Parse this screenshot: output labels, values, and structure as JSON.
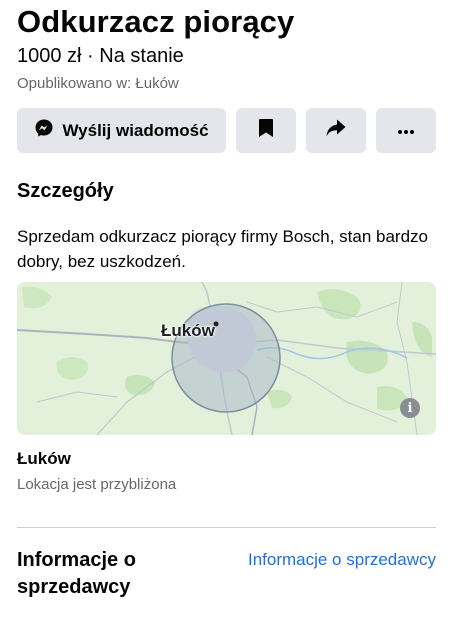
{
  "listing": {
    "title": "Odkurzacz piorący",
    "price_line": "1000 zł · Na stanie",
    "published": "Opublikowano w: Łuków"
  },
  "actions": {
    "message_label": "Wyślij wiadomość",
    "message_icon": "messenger-icon",
    "save_icon": "bookmark-icon",
    "share_icon": "share-arrow-icon",
    "more_icon": "more-dots-icon"
  },
  "details": {
    "heading": "Szczegóły",
    "description": "Sprzedam odkurzacz piorący firmy Bosch,  stan bardzo dobry, bez uszkodzeń."
  },
  "map": {
    "city_label": "Łuków",
    "info_glyph": "i"
  },
  "location": {
    "name": "Łuków",
    "note": "Lokacja jest przybliżona"
  },
  "seller": {
    "heading": "Informacje o sprzedawcy",
    "link": "Informacje o sprzedawcy"
  },
  "colors": {
    "button_bg": "#e4e6eb",
    "link": "#216fdb",
    "secondary_text": "#65676b",
    "map_bg": "#e3f1da"
  }
}
